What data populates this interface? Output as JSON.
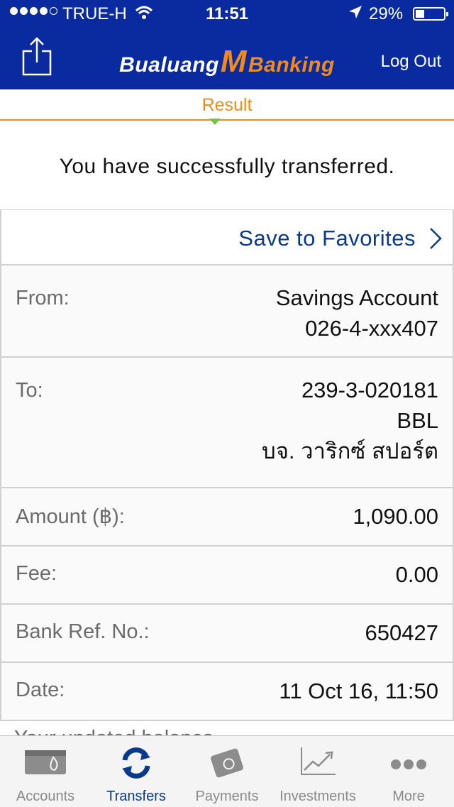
{
  "status_bar": {
    "carrier": "TRUE-H",
    "time": "11:51",
    "battery": "29%",
    "battery_level": 0.29,
    "icons": [
      "signal-dots-icon",
      "wifi-icon",
      "location-arrow-icon",
      "battery-icon"
    ]
  },
  "header": {
    "brand_left": "Bualuang",
    "brand_mark": "M",
    "brand_right": "Banking",
    "logout_label": "Log Out",
    "share_icon": "share-icon",
    "colors": {
      "background": "#0a2aa0",
      "accent": "#f08a1c"
    }
  },
  "step": {
    "label": "Result",
    "indicator_color": "#7ac142"
  },
  "message": "You have successfully transferred.",
  "favorites": {
    "label": "Save to Favorites",
    "icon": "chevron-right-icon"
  },
  "details": {
    "from": {
      "label": "From:",
      "lines": [
        "Savings Account",
        "026-4-xxx407"
      ]
    },
    "to": {
      "label": "To:",
      "lines": [
        "239-3-020181",
        "BBL",
        "บจ. วาริกซ์ สปอร์ต"
      ]
    },
    "amount": {
      "label": "Amount (฿):",
      "value": "1,090.00"
    },
    "fee": {
      "label": "Fee:",
      "value": "0.00"
    },
    "ref": {
      "label": "Bank Ref. No.:",
      "value": "650427"
    },
    "date": {
      "label": "Date:",
      "value": "11 Oct 16, 11:50"
    }
  },
  "partial_text": "Your updated balance",
  "tabs": [
    {
      "label": "Accounts",
      "icon": "wallet-icon",
      "active": false
    },
    {
      "label": "Transfers",
      "icon": "transfer-arrows-icon",
      "active": true
    },
    {
      "label": "Payments",
      "icon": "payment-card-icon",
      "active": false
    },
    {
      "label": "Investments",
      "icon": "chart-line-icon",
      "active": false
    },
    {
      "label": "More",
      "icon": "more-dots-icon",
      "active": false
    }
  ]
}
